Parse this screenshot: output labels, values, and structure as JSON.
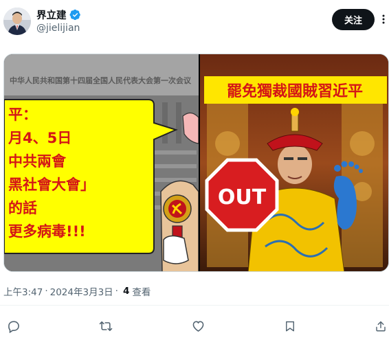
{
  "author": {
    "name": "界立建",
    "handle": "@jielijian",
    "verified": true
  },
  "follow_label": "关注",
  "media": {
    "left": {
      "banner": "中华人民共和国第十四届全国人民代表大会第一次会议",
      "speech_lines": [
        "平：",
        "月4、5日",
        "中共兩會",
        "黑社會大會」",
        "的話",
        "更多病毒!!!"
      ]
    },
    "right": {
      "banner": "罷免獨裁國賊習近平",
      "stop_sign": "OUT"
    }
  },
  "meta": {
    "time": "上午3:47",
    "separator": "·",
    "date": "2024年3月3日",
    "views_count": "4",
    "views_label": "查看"
  },
  "actions": [
    {
      "name": "reply-icon"
    },
    {
      "name": "retweet-icon"
    },
    {
      "name": "like-icon"
    },
    {
      "name": "bookmark-icon"
    },
    {
      "name": "share-icon"
    }
  ],
  "colors": {
    "accent": "#1d9bf0",
    "yellow_bubble": "#ffff00",
    "red_banner": "#e0201b",
    "stop_sign": "#d81d20"
  }
}
